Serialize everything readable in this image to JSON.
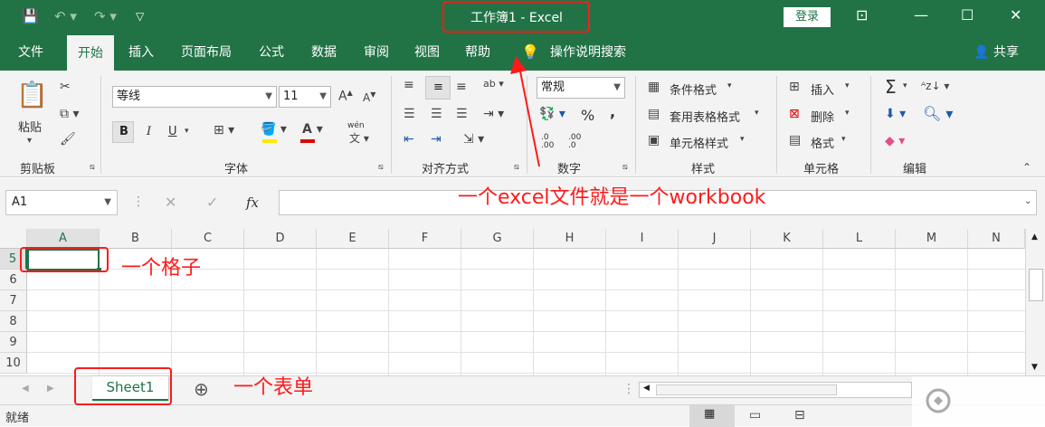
{
  "titlebar": {
    "title": "工作簿1  -  Excel",
    "login": "登录",
    "icons": [
      "save-icon",
      "undo-icon",
      "redo-icon",
      "customize-icon",
      "restore-ribbon-icon",
      "minimize-icon",
      "maximize-icon",
      "close-icon"
    ]
  },
  "tabs": [
    "文件",
    "开始",
    "插入",
    "页面布局",
    "公式",
    "数据",
    "审阅",
    "视图",
    "帮助"
  ],
  "tell_me": "操作说明搜索",
  "share": "共享",
  "ribbon": {
    "clipboard": {
      "paste": "粘贴",
      "label": "剪贴板"
    },
    "font": {
      "name": "等线",
      "size": "11",
      "label": "字体",
      "bold": "B",
      "italic": "I",
      "underline": "U",
      "phonetic": "wén"
    },
    "alignment": {
      "label": "对齐方式"
    },
    "number": {
      "format": "常规",
      "label": "数字",
      "percent": "%",
      "comma": ",",
      "inc": ".0 .00",
      "dec": ".00 .0"
    },
    "styles": {
      "cond": "条件格式",
      "table": "套用表格格式",
      "cell": "单元格样式",
      "label": "样式"
    },
    "cells": {
      "insert": "插入",
      "delete": "删除",
      "format": "格式",
      "label": "单元格"
    },
    "editing": {
      "label": "编辑",
      "sum": "Σ"
    }
  },
  "formula_bar": {
    "name_box": "A1",
    "fx": "fx"
  },
  "columns": [
    "A",
    "B",
    "C",
    "D",
    "E",
    "F",
    "G",
    "H",
    "I",
    "J",
    "K",
    "L",
    "M",
    "N"
  ],
  "rows": [
    "5",
    "6",
    "7",
    "8",
    "9",
    "10"
  ],
  "sheet": {
    "name": "Sheet1",
    "add": "⊕"
  },
  "status": {
    "ready": "就绪"
  },
  "annotations": {
    "workbook": "一个excel文件就是一个workbook",
    "cell": "一个格子",
    "sheet": "一个表单"
  },
  "colors": {
    "excel_green": "#217346",
    "annotation_red": "#ff1a1a"
  }
}
